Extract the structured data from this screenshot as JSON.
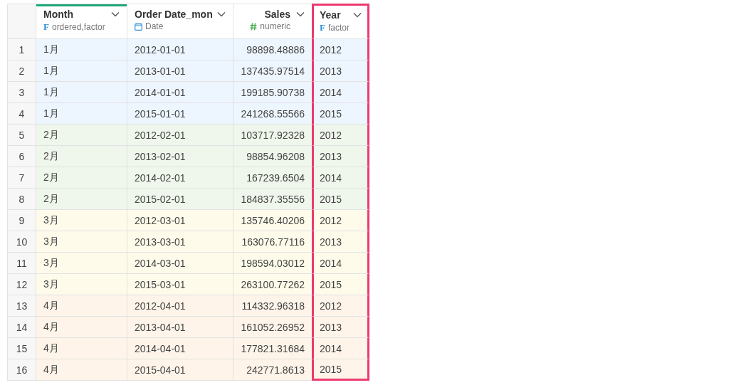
{
  "table": {
    "columns": [
      {
        "name": "Month",
        "type": "ordered,factor",
        "kind": "factor",
        "icon": "F",
        "selected": true,
        "highlighted": false
      },
      {
        "name": "Order Date_mon",
        "type": "Date",
        "kind": "date",
        "selected": false,
        "highlighted": false
      },
      {
        "name": "Sales",
        "type": "numeric",
        "kind": "numeric",
        "selected": false,
        "highlighted": false
      },
      {
        "name": "Year",
        "type": "factor",
        "kind": "factor",
        "icon": "F",
        "selected": false,
        "highlighted": true
      }
    ],
    "rows": [
      {
        "number": "1",
        "color": "#edf5fe",
        "cells": [
          "1月",
          "2012-01-01",
          "98898.48886",
          "2012"
        ]
      },
      {
        "number": "2",
        "color": "#edf5fe",
        "cells": [
          "1月",
          "2013-01-01",
          "137435.97514",
          "2013"
        ]
      },
      {
        "number": "3",
        "color": "#edf5fe",
        "cells": [
          "1月",
          "2014-01-01",
          "199185.90738",
          "2014"
        ]
      },
      {
        "number": "4",
        "color": "#edf5fe",
        "cells": [
          "1月",
          "2015-01-01",
          "241268.55566",
          "2015"
        ]
      },
      {
        "number": "5",
        "color": "#eff6eb",
        "cells": [
          "2月",
          "2012-02-01",
          "103717.92328",
          "2012"
        ]
      },
      {
        "number": "6",
        "color": "#eff6eb",
        "cells": [
          "2月",
          "2013-02-01",
          "98854.96208",
          "2013"
        ]
      },
      {
        "number": "7",
        "color": "#eff6eb",
        "cells": [
          "2月",
          "2014-02-01",
          "167239.6504",
          "2014"
        ]
      },
      {
        "number": "8",
        "color": "#eff6eb",
        "cells": [
          "2月",
          "2015-02-01",
          "184837.35556",
          "2015"
        ]
      },
      {
        "number": "9",
        "color": "#fefbea",
        "cells": [
          "3月",
          "2012-03-01",
          "135746.40206",
          "2012"
        ]
      },
      {
        "number": "10",
        "color": "#fefbea",
        "cells": [
          "3月",
          "2013-03-01",
          "163076.77116",
          "2013"
        ]
      },
      {
        "number": "11",
        "color": "#fefbea",
        "cells": [
          "3月",
          "2014-03-01",
          "198594.03012",
          "2014"
        ]
      },
      {
        "number": "12",
        "color": "#fefbea",
        "cells": [
          "3月",
          "2015-03-01",
          "263100.77262",
          "2015"
        ]
      },
      {
        "number": "13",
        "color": "#fef4e9",
        "cells": [
          "4月",
          "2012-04-01",
          "114332.96318",
          "2012"
        ]
      },
      {
        "number": "14",
        "color": "#fef4e9",
        "cells": [
          "4月",
          "2013-04-01",
          "161052.26952",
          "2013"
        ]
      },
      {
        "number": "15",
        "color": "#fef4e9",
        "cells": [
          "4月",
          "2014-04-01",
          "177821.31684",
          "2014"
        ]
      },
      {
        "number": "16",
        "color": "#fef4e9",
        "cells": [
          "4月",
          "2015-04-01",
          "242771.8613",
          "2015"
        ]
      }
    ]
  }
}
